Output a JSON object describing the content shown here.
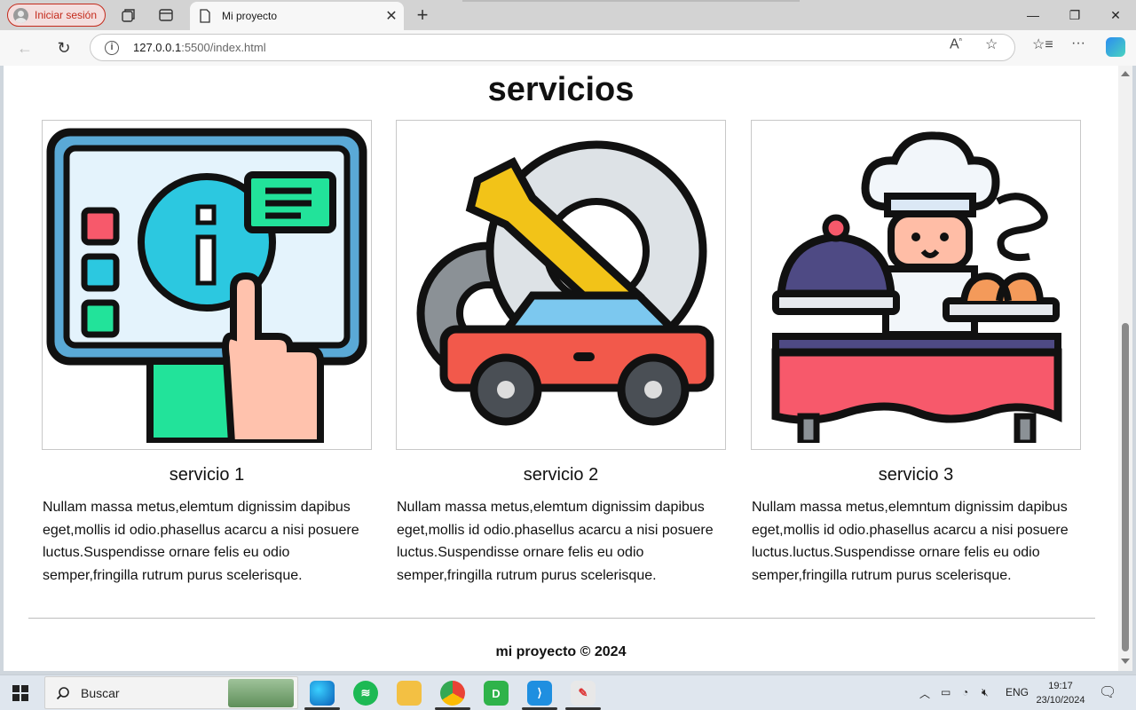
{
  "browser": {
    "profile_label": "Iniciar sesión",
    "tab_title": "Mi proyecto",
    "url_host": "127.0.0.1",
    "url_rest": ":5500/index.html"
  },
  "page": {
    "section_title": "servicios",
    "cards": [
      {
        "title": "servicio 1",
        "text": "Nullam massa metus,elemtum dignissim dapibus eget,mollis id odio.phasellus acarcu a nisi posuere luctus.Suspendisse ornare felis eu odio semper,fringilla rutrum purus scelerisque."
      },
      {
        "title": "servicio 2",
        "text": "Nullam massa metus,elemtum dignissim dapibus eget,mollis id odio.phasellus acarcu a nisi posuere luctus.Suspendisse ornare felis eu odio semper,fringilla rutrum purus scelerisque."
      },
      {
        "title": "servicio 3",
        "text": "Nullam massa metus,elemntum dignissim dapibus eget,mollis id odio.phasellus acarcu a nisi posuere luctus.luctus.Suspendisse ornare felis eu odio semper,fringilla rutrum purus scelerisque."
      }
    ],
    "footer": "mi proyecto © 2024"
  },
  "taskbar": {
    "search_label": "Buscar",
    "language": "ENG",
    "time": "19:17",
    "date": "23/10/2024"
  },
  "icons": {
    "card1": "info-kiosk-icon",
    "card2": "car-repair-icon",
    "card3": "chef-catering-icon"
  }
}
